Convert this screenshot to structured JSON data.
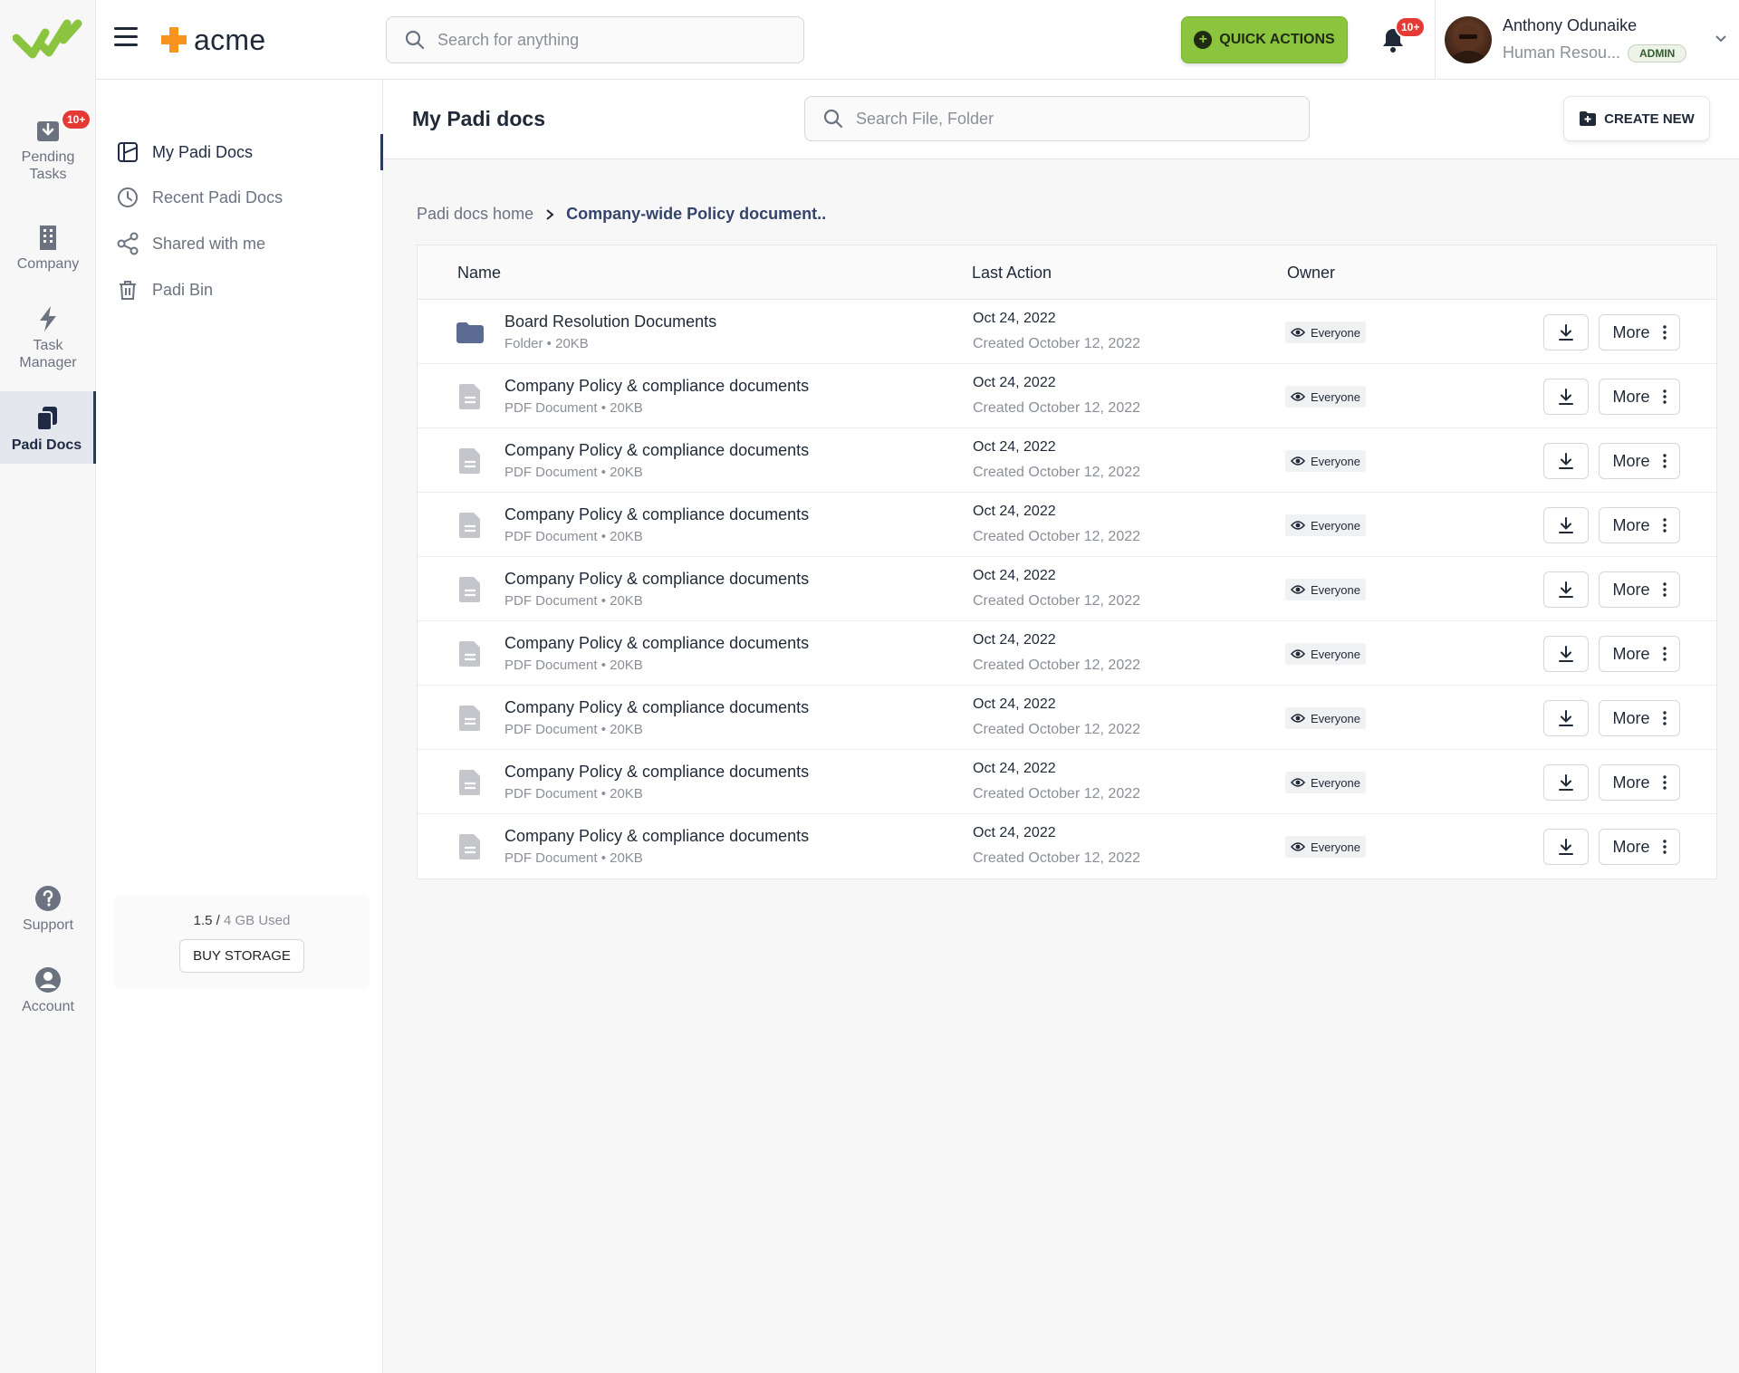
{
  "rail": {
    "items": [
      {
        "label_line1": "Pending",
        "label_line2": "Tasks",
        "badge": "10+"
      },
      {
        "label_line1": "Company",
        "label_line2": ""
      },
      {
        "label_line1": "Task",
        "label_line2": "Manager"
      },
      {
        "label_line1": "Padi Docs",
        "label_line2": ""
      },
      {
        "label_line1": "Support",
        "label_line2": ""
      },
      {
        "label_line1": "Account",
        "label_line2": ""
      }
    ]
  },
  "topbar": {
    "brand": "acme",
    "search_placeholder": "Search for anything",
    "quick_actions": "QUICK ACTIONS",
    "notif_badge": "10+",
    "user_name": "Anthony Odunaike",
    "user_role": "Human Resou...",
    "user_tag": "ADMIN"
  },
  "subnav": {
    "items": [
      {
        "label": "My Padi Docs"
      },
      {
        "label": "Recent Padi Docs"
      },
      {
        "label": "Shared with me"
      },
      {
        "label": "Padi Bin"
      }
    ],
    "storage_used": "1.5 /",
    "storage_total": " 4 GB Used",
    "buy_storage": "BUY STORAGE"
  },
  "main": {
    "title": "My Padi docs",
    "search_placeholder": "Search File, Folder",
    "create_new": "CREATE NEW",
    "breadcrumb_home": "Padi docs home",
    "breadcrumb_current": "Company-wide Policy document..",
    "columns": {
      "name": "Name",
      "last_action": "Last Action",
      "owner": "Owner"
    },
    "more_label": "More",
    "rows": [
      {
        "name": "Board Resolution Documents",
        "meta": "Folder • 20KB",
        "date": "Oct 24, 2022",
        "created": "Created October 12, 2022",
        "owner": "Everyone",
        "kind": "folder"
      },
      {
        "name": "Company Policy & compliance documents",
        "meta": "PDF Document • 20KB",
        "date": "Oct 24, 2022",
        "created": "Created October 12, 2022",
        "owner": "Everyone",
        "kind": "doc"
      },
      {
        "name": "Company Policy & compliance documents",
        "meta": "PDF Document • 20KB",
        "date": "Oct 24, 2022",
        "created": "Created October 12, 2022",
        "owner": "Everyone",
        "kind": "doc"
      },
      {
        "name": "Company Policy & compliance documents",
        "meta": "PDF Document • 20KB",
        "date": "Oct 24, 2022",
        "created": "Created October 12, 2022",
        "owner": "Everyone",
        "kind": "doc"
      },
      {
        "name": "Company Policy & compliance documents",
        "meta": "PDF Document • 20KB",
        "date": "Oct 24, 2022",
        "created": "Created October 12, 2022",
        "owner": "Everyone",
        "kind": "doc"
      },
      {
        "name": "Company Policy & compliance documents",
        "meta": "PDF Document • 20KB",
        "date": "Oct 24, 2022",
        "created": "Created October 12, 2022",
        "owner": "Everyone",
        "kind": "doc"
      },
      {
        "name": "Company Policy & compliance documents",
        "meta": "PDF Document • 20KB",
        "date": "Oct 24, 2022",
        "created": "Created October 12, 2022",
        "owner": "Everyone",
        "kind": "doc"
      },
      {
        "name": "Company Policy & compliance documents",
        "meta": "PDF Document • 20KB",
        "date": "Oct 24, 2022",
        "created": "Created October 12, 2022",
        "owner": "Everyone",
        "kind": "doc"
      },
      {
        "name": "Company Policy & compliance documents",
        "meta": "PDF Document • 20KB",
        "date": "Oct 24, 2022",
        "created": "Created October 12, 2022",
        "owner": "Everyone",
        "kind": "doc"
      }
    ]
  },
  "colors": {
    "accent_green": "#8bc53f",
    "brand_orange": "#f7941d",
    "nav_active": "#2d3a5c",
    "badge_red": "#e53935"
  },
  "icons": {
    "rail": [
      "inbox-icon",
      "building-icon",
      "bolt-icon",
      "docs-icon",
      "help-icon",
      "user-circle-icon"
    ],
    "row_actions": [
      "download-icon",
      "kebab-icon"
    ]
  }
}
